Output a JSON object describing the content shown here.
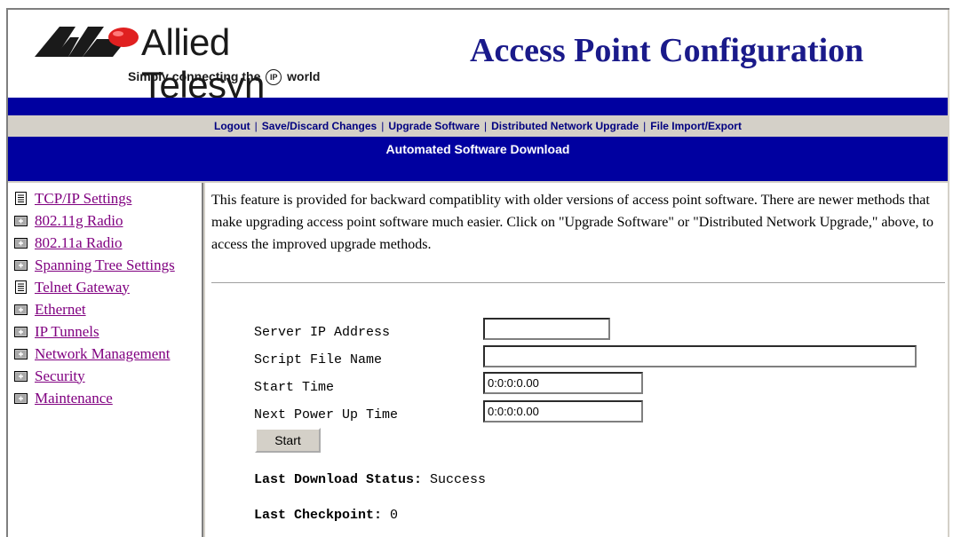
{
  "header": {
    "brand_name": "Allied Telesyn",
    "tagline_prefix": "Simply connecting the",
    "tagline_ip": "IP",
    "tagline_suffix": "world",
    "title": "Access Point Configuration",
    "brand_color": "#1a1a8a"
  },
  "nav": {
    "links": [
      {
        "label": "Logout"
      },
      {
        "label": "Save/Discard Changes"
      },
      {
        "label": "Upgrade Software"
      },
      {
        "label": "Distributed Network Upgrade"
      },
      {
        "label": "File Import/Export"
      }
    ],
    "section_title": "Automated Software Download",
    "bar_color": "#0000a0"
  },
  "sidebar": {
    "items": [
      {
        "label": "TCP/IP Settings",
        "icon": "document-icon"
      },
      {
        "label": "802.11g Radio",
        "icon": "folder-icon"
      },
      {
        "label": "802.11a Radio",
        "icon": "folder-icon"
      },
      {
        "label": "Spanning Tree Settings",
        "icon": "folder-icon"
      },
      {
        "label": "Telnet Gateway",
        "icon": "document-icon"
      },
      {
        "label": "Ethernet",
        "icon": "folder-icon"
      },
      {
        "label": "IP Tunnels",
        "icon": "folder-icon"
      },
      {
        "label": "Network Management",
        "icon": "folder-icon"
      },
      {
        "label": "Security",
        "icon": "folder-icon"
      },
      {
        "label": "Maintenance",
        "icon": "folder-icon"
      }
    ],
    "link_color": "#800080"
  },
  "main": {
    "intro": "This feature is provided for backward compatiblity with older versions of access point software. There are newer methods that make upgrading access point software much easier. Click on \"Upgrade Software\" or \"Distributed Network Upgrade,\" above, to access the improved upgrade methods.",
    "form": {
      "server_ip_label": "Server IP Address",
      "server_ip_value": "",
      "script_file_label": "Script File Name",
      "script_file_value": "",
      "start_time_label": "Start Time",
      "start_time_value": "0:0:0:0.00",
      "next_power_up_label": "Next Power Up Time",
      "next_power_up_value": "0:0:0:0.00",
      "start_button": "Start"
    },
    "status": {
      "last_download_label": "Last Download Status:",
      "last_download_value": "Success",
      "last_checkpoint_label": "Last Checkpoint:",
      "last_checkpoint_value": "0"
    }
  }
}
